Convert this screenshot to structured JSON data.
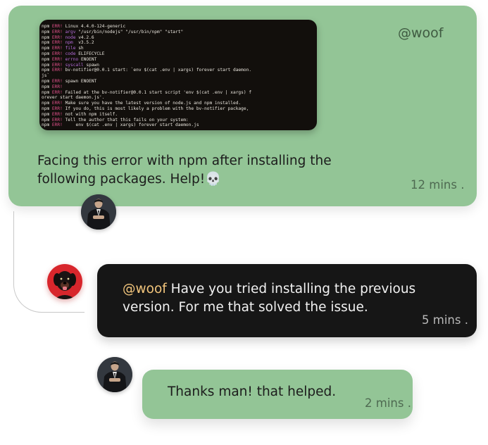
{
  "post": {
    "handle": "@woof",
    "message": "Facing this error with npm after installing the following packages. Help!💀",
    "time": "12 mins .",
    "terminal_lines": [
      {
        "prefix": "npm",
        "code": "ERR!",
        "key": "",
        "text": "Linux 4.4.0-124-generic"
      },
      {
        "prefix": "npm",
        "code": "ERR!",
        "key": "argv",
        "text": "\"/usr/bin/nodejs\" \"/usr/bin/npm\" \"start\""
      },
      {
        "prefix": "npm",
        "code": "ERR!",
        "key": "node",
        "text": "v4.2.6"
      },
      {
        "prefix": "npm",
        "code": "ERR!",
        "key": "npm",
        "text": " v3.5.2"
      },
      {
        "prefix": "npm",
        "code": "ERR!",
        "key": "file",
        "text": "sh"
      },
      {
        "prefix": "npm",
        "code": "ERR!",
        "key": "code",
        "text": "ELIFECYCLE"
      },
      {
        "prefix": "npm",
        "code": "ERR!",
        "key": "errno",
        "text": "ENOENT"
      },
      {
        "prefix": "npm",
        "code": "ERR!",
        "key": "syscall",
        "text": "spawn"
      },
      {
        "prefix": "npm",
        "code": "ERR!",
        "key": "",
        "text": "bv-notifier@0.0.1 start: `env $(cat .env | xargs) forever start daemon."
      },
      {
        "prefix": "",
        "code": "",
        "key": "",
        "text": "js`"
      },
      {
        "prefix": "npm",
        "code": "ERR!",
        "key": "",
        "text": "spawn ENOENT"
      },
      {
        "prefix": "npm",
        "code": "ERR!",
        "key": "",
        "text": ""
      },
      {
        "prefix": "npm",
        "code": "ERR!",
        "key": "",
        "text": "Failed at the bv-notifier@0.0.1 start script 'env $(cat .env | xargs) f"
      },
      {
        "prefix": "",
        "code": "",
        "key": "",
        "text": "orever start daemon.js'."
      },
      {
        "prefix": "npm",
        "code": "ERR!",
        "key": "",
        "text": "Make sure you have the latest version of node.js and npm installed."
      },
      {
        "prefix": "npm",
        "code": "ERR!",
        "key": "",
        "text": "If you do, this is most likely a problem with the bv-notifier package,"
      },
      {
        "prefix": "npm",
        "code": "ERR!",
        "key": "",
        "text": "not with npm itself."
      },
      {
        "prefix": "npm",
        "code": "ERR!",
        "key": "",
        "text": "Tell the author that this fails on your system:"
      },
      {
        "prefix": "npm",
        "code": "ERR!",
        "key": "",
        "text": "    env $(cat .env | xargs) forever start daemon.js"
      }
    ]
  },
  "reply": {
    "mention": "@woof",
    "message": " Have you tried installing the previous version. For me that solved the issue.",
    "time": "5 mins ."
  },
  "reply2": {
    "message": "Thanks man! that helped.",
    "time": "2 mins ."
  },
  "avatars": {
    "post_author": "avatar-man-in-suit",
    "reply_author": "avatar-dog-red",
    "reply2_author": "avatar-man-in-suit"
  },
  "colors": {
    "green_card": "#93c596",
    "dark_card": "#161616",
    "mention": "#f2c57c",
    "terminal_bg": "#120f0c",
    "terminal_err": "#e0508a"
  }
}
